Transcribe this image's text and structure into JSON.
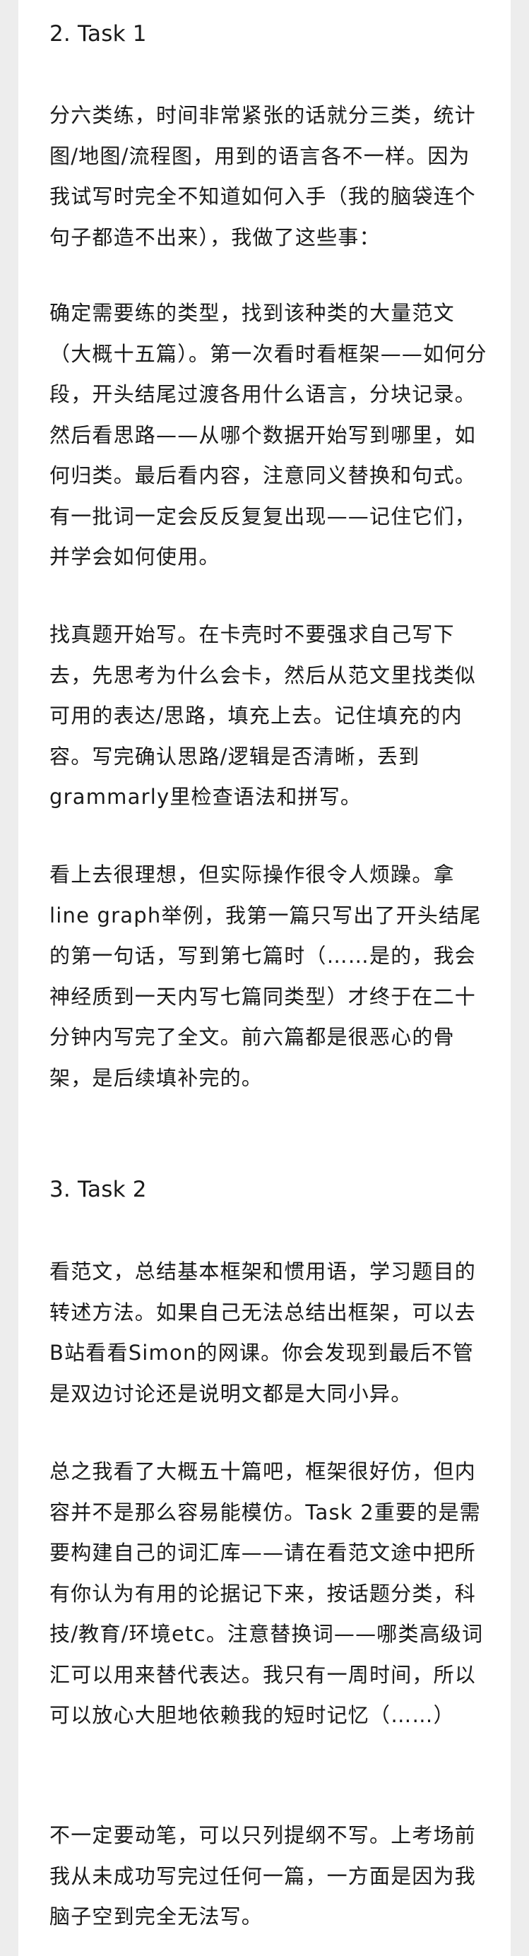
{
  "sections": [
    {
      "heading": "2. Task 1",
      "paragraphs": [
        "分六类练，时间非常紧张的话就分三类，统计图/地图/流程图，用到的语言各不一样。因为我试写时完全不知道如何入手（我的脑袋连个句子都造不出来），我做了这些事：",
        "确定需要练的类型，找到该种类的大量范文（大概十五篇）。第一次看时看框架——如何分段，开头结尾过渡各用什么语言，分块记录。然后看思路——从哪个数据开始写到哪里，如何归类。最后看内容，注意同义替换和句式。有一批词一定会反反复复出现——记住它们，并学会如何使用。",
        "找真题开始写。在卡壳时不要强求自己写下去，先思考为什么会卡，然后从范文里找类似可用的表达/思路，填充上去。记住填充的内容。写完确认思路/逻辑是否清晰，丢到grammarly里检查语法和拼写。",
        "看上去很理想，但实际操作很令人烦躁。拿line graph举例，我第一篇只写出了开头结尾的第一句话，写到第七篇时（……是的，我会神经质到一天内写七篇同类型）才终于在二十分钟内写完了全文。前六篇都是很恶心的骨架，是后续填补完的。"
      ]
    },
    {
      "heading": "3. Task 2",
      "paragraphs": [
        "看范文，总结基本框架和惯用语，学习题目的转述方法。如果自己无法总结出框架，可以去B站看看Simon的网课。你会发现到最后不管是双边讨论还是说明文都是大同小异。",
        "总之我看了大概五十篇吧，框架很好仿，但内容并不是那么容易能模仿。Task 2重要的是需要构建自己的词汇库——请在看范文途中把所有你认为有用的论据记下来，按话题分类，科技/教育/环境etc。注意替换词——哪类高级词汇可以用来替代表达。我只有一周时间，所以可以放心大胆地依赖我的短时记忆（……）",
        "不一定要动笔，可以只列提纲不写。上考场前我从未成功写完过任何一篇，一方面是因为我脑子空到完全无法写。"
      ]
    }
  ]
}
